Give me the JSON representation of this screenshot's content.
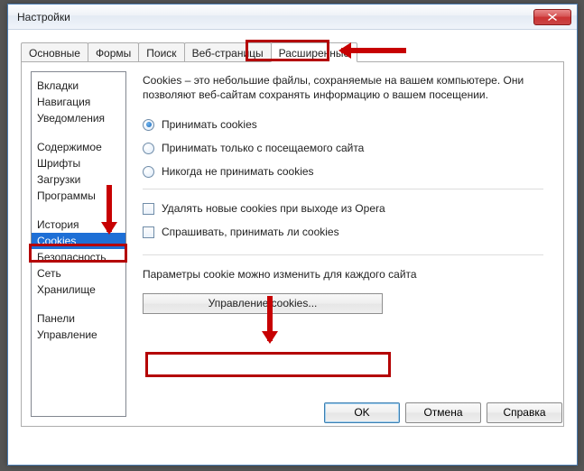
{
  "window": {
    "title": "Настройки"
  },
  "tabs": [
    {
      "label": "Основные"
    },
    {
      "label": "Формы"
    },
    {
      "label": "Поиск"
    },
    {
      "label": "Веб-страницы"
    },
    {
      "label": "Расширенные"
    }
  ],
  "sidebar": {
    "group1": [
      "Вкладки",
      "Навигация",
      "Уведомления"
    ],
    "group2": [
      "Содержимое",
      "Шрифты",
      "Загрузки",
      "Программы"
    ],
    "group3": [
      "История",
      "Cookies",
      "Безопасность",
      "Сеть",
      "Хранилище"
    ],
    "group4": [
      "Панели",
      "Управление"
    ]
  },
  "main": {
    "description": "Cookies – это небольшие файлы, сохраняемые на вашем компьютере. Они позволяют веб-сайтам сохранять информацию о вашем посещении.",
    "radios": {
      "accept": "Принимать cookies",
      "visited": "Принимать только с посещаемого сайта",
      "never": "Никогда не принимать cookies"
    },
    "checks": {
      "delete_on_exit": "Удалять новые cookies при выходе из Opera",
      "ask": "Спрашивать, принимать ли cookies"
    },
    "per_site_note": "Параметры cookie можно изменить для каждого сайта",
    "manage_button": "Управление cookies..."
  },
  "buttons": {
    "ok": "OK",
    "cancel": "Отмена",
    "help": "Справка"
  }
}
